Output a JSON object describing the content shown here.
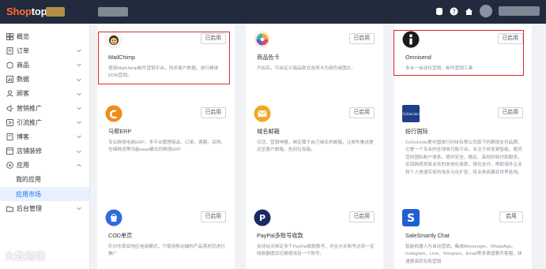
{
  "brand": {
    "name_prefix": "Shop",
    "name_suffix": "top"
  },
  "topbar": {
    "icons": [
      "database-icon",
      "help-icon",
      "home-icon",
      "avatar"
    ]
  },
  "sidebar": {
    "items": [
      {
        "label": "概览",
        "icon": "overview-icon",
        "expandable": false
      },
      {
        "label": "订单",
        "icon": "order-icon",
        "expandable": true
      },
      {
        "label": "商品",
        "icon": "product-icon",
        "expandable": true
      },
      {
        "label": "数据",
        "icon": "data-icon",
        "expandable": true
      },
      {
        "label": "顾客",
        "icon": "customer-icon",
        "expandable": true
      },
      {
        "label": "营销推广",
        "icon": "marketing-icon",
        "expandable": true
      },
      {
        "label": "引流推广",
        "icon": "traffic-icon",
        "expandable": true
      },
      {
        "label": "博客",
        "icon": "blog-icon",
        "expandable": true
      },
      {
        "label": "店铺装修",
        "icon": "decoration-icon",
        "expandable": true
      },
      {
        "label": "应用",
        "icon": "apps-icon",
        "expandable": true
      },
      {
        "label": "我的应用",
        "sub": true
      },
      {
        "label": "应用市场",
        "sub": true,
        "active": true
      },
      {
        "label": "后台管理",
        "icon": "admin-icon",
        "expandable": true
      }
    ]
  },
  "apps": [
    {
      "name": "MailChimp",
      "desc": "使用Mailchimp邮件营销平台，同步客户数据，进行精准EDM营销。",
      "button": "已启用",
      "logo": "mailchimp-logo"
    },
    {
      "name": "商品色卡",
      "desc": "开启后，可自定义商品款式选项卡为颜色或图片。",
      "button": "已启用",
      "logo": "color-card-logo"
    },
    {
      "name": "Omnisend",
      "desc": "多合一自动化营销，邮件营销工具",
      "button": "已启用",
      "logo": "omnisend-logo"
    },
    {
      "name": "马帮ERP",
      "desc": "专业跨境电商ERP，多平台管理商品、订单、客服、采购、仓储物流等功能saas模式的跨境ERP",
      "button": "已启用",
      "logo": "mabang-logo"
    },
    {
      "name": "域名邮箱",
      "desc": "日活、营销神器，绑定属于自己域名的邮箱，让邮件推送更达至客户邮箱，告别垃圾箱。",
      "button": "已启用",
      "logo": "domain-mail-logo"
    },
    {
      "name": "纷行国际",
      "desc": "CoGoLinks是中国旅行科技有限公司旗下的跨境支付品牌。它是一个专业的全球收付款平台，专注于研发更智能、更灵活的国际账户体系。提供安全、稳定、高效的收付款服务，实现跨境贸易业务的本地化收款，强化支付，帮助海外企业和个人快速实现市场多元化扩张，将业务拓展到世界各地。",
      "button": "已启用",
      "logo": "cogolinks-logo"
    },
    {
      "name": "COD单页",
      "desc": "针对东南亚地区电商模式，只使用移动端的产品落地页进行推广",
      "button": "已启用",
      "logo": "cod-logo"
    },
    {
      "name": "PayPal多账号收款",
      "desc": "支持站点绑定多个PayPal收款账号，并且允许账号达到一定收款额度后切换使用另一个账号。",
      "button": "已启用",
      "logo": "paypal-logo"
    },
    {
      "name": "SaleSmartly Chat",
      "desc": "智能机器人与自动营销。集成Messenger、WhatsApp、Instagram、Line、Telegram、Email等多渠道聊天客服，快速提高转化和营销",
      "button": "启用",
      "logo": "salesmartly-logo"
    }
  ],
  "watermark": "大数跨境",
  "colors": {
    "topbar": "#222a3d",
    "accent": "#1d6cf0",
    "highlight": "#e0262b",
    "brand": "#ff6a3d"
  }
}
